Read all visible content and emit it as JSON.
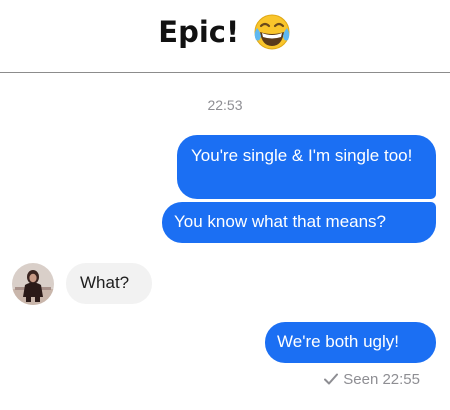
{
  "header": {
    "title": "Epic!",
    "emoji_icon": "face-with-tears-of-joy-icon"
  },
  "conversation": {
    "timestamp": "22:53",
    "messages": [
      {
        "from": "me",
        "text": "You're single & I'm single too!"
      },
      {
        "from": "me",
        "text": "You know what that means?"
      },
      {
        "from": "them",
        "text": "What?"
      },
      {
        "from": "me",
        "text": "We're both ugly!"
      }
    ],
    "seen": {
      "check_icon": "checkmark-icon",
      "text": "Seen 22:55"
    }
  },
  "colors": {
    "outgoing_bubble": "#1b6ff3",
    "incoming_bubble": "#f2f2f2",
    "meta_text": "#8e8e93"
  }
}
